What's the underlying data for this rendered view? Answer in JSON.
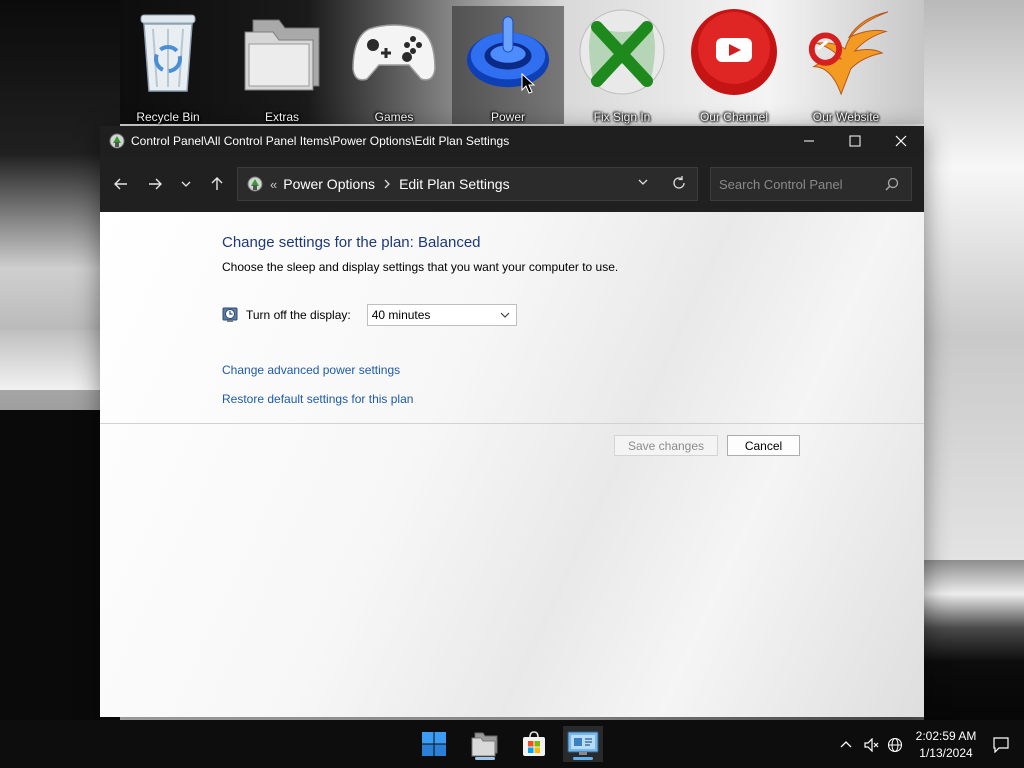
{
  "desktop": {
    "icons": [
      {
        "label": "Recycle Bin",
        "icon": "recycle-bin-icon"
      },
      {
        "label": "Extras",
        "icon": "folder-icon"
      },
      {
        "label": "Games",
        "icon": "gamepad-icon"
      },
      {
        "label": "Power",
        "icon": "power-icon"
      },
      {
        "label": "Fix Sign In",
        "icon": "xbox-icon"
      },
      {
        "label": "Our Channel",
        "icon": "youtube-icon"
      },
      {
        "label": "Our Website",
        "icon": "phoenix-icon"
      }
    ]
  },
  "window": {
    "title": "Control Panel\\All Control Panel Items\\Power Options\\Edit Plan Settings",
    "address": {
      "overflow": "«",
      "crumbs": [
        "Power Options",
        "Edit Plan Settings"
      ]
    },
    "search_placeholder": "Search Control Panel",
    "heading": "Change settings for the plan: Balanced",
    "subtext": "Choose the sleep and display settings that you want your computer to use.",
    "display_label": "Turn off the display:",
    "display_value": "40 minutes",
    "links": {
      "advanced": "Change advanced power settings",
      "restore": "Restore default settings for this plan"
    },
    "buttons": {
      "save": "Save changes",
      "cancel": "Cancel"
    }
  },
  "taskbar": {
    "clock_time": "2:02:59 AM",
    "clock_date": "1/13/2024"
  },
  "colors": {
    "heading": "#1e3a78",
    "link": "#1e5aa8",
    "titlebar": "#1f1f1f",
    "taskbar": "#0d0d0d",
    "accent": "#5fb2f2"
  }
}
